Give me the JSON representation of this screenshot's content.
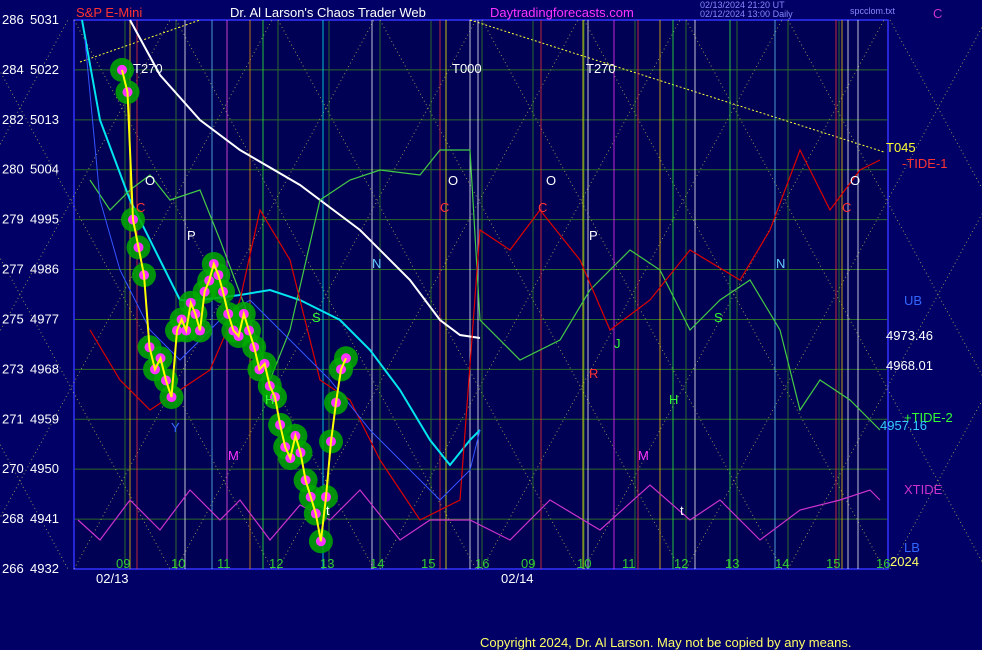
{
  "header": {
    "symbol": "S&P E-Mini",
    "title": "Dr. Al Larson's Chaos Trader Web",
    "site": "Daytradingforecasts.com",
    "stamp1": "02/13/2024 21:20 UT",
    "stamp2": "02/12/2024 13:00 Daily",
    "file": "spcclom.txt",
    "corner": "C"
  },
  "footer": {
    "copyright": "Copyright 2024, Dr. Al Larson. May not be copied by any means."
  },
  "colors": {
    "background": "#000066",
    "plot_bg": "#000055",
    "grid": "#2a6a2a",
    "price_bar": "#00aa00",
    "yellow_avg": "#ffff00",
    "cyan_avg": "#00e5ee",
    "white_avg": "#ffffff",
    "tide_red": "#dd0000",
    "green_line": "#44cc44",
    "xtide": "#cc33cc",
    "magenta_dots": "#ff33ff",
    "axis_text": "#ffffff"
  },
  "chart_data": {
    "type": "line",
    "title": "S&P E-Mini",
    "y_left_ticks": [
      {
        "a": "286",
        "b": "5031"
      },
      {
        "a": "284",
        "b": "5022"
      },
      {
        "a": "282",
        "b": "5013"
      },
      {
        "a": "280",
        "b": "5004"
      },
      {
        "a": "279",
        "b": "4995"
      },
      {
        "a": "277",
        "b": "4986"
      },
      {
        "a": "275",
        "b": "4977"
      },
      {
        "a": "273",
        "b": "4968"
      },
      {
        "a": "271",
        "b": "4959"
      },
      {
        "a": "270",
        "b": "4950"
      },
      {
        "a": "268",
        "b": "4941"
      },
      {
        "a": "266",
        "b": "4932"
      }
    ],
    "ylim": [
      4932,
      5031
    ],
    "x_hour_labels": [
      "09",
      "10",
      "11",
      "12",
      "13",
      "14",
      "15",
      "16",
      "09",
      "10",
      "11",
      "12",
      "13",
      "14",
      "15",
      "16"
    ],
    "x_date_labels": [
      "02/13",
      "02/14"
    ],
    "x_year": "2024",
    "right_labels": {
      "t045": "T045",
      "tide1": "-TIDE-1",
      "ub": "UB",
      "v1": "4973.46",
      "v2": "4968.01",
      "tide2": "+TIDE-2",
      "v3": "4957.16",
      "xtide": "XTIDE",
      "lb": "LB"
    },
    "top_labels": [
      "T270",
      "T000",
      "T270"
    ],
    "price": [
      [
        0.0,
        5022
      ],
      [
        0.1,
        5018
      ],
      [
        0.2,
        4995
      ],
      [
        0.3,
        4990
      ],
      [
        0.4,
        4985
      ],
      [
        0.5,
        4972
      ],
      [
        0.6,
        4968
      ],
      [
        0.7,
        4970
      ],
      [
        0.8,
        4966
      ],
      [
        0.9,
        4963
      ],
      [
        1.0,
        4975
      ],
      [
        1.1,
        4977
      ],
      [
        1.2,
        4975
      ],
      [
        1.3,
        4980
      ],
      [
        1.4,
        4978
      ],
      [
        1.5,
        4975
      ],
      [
        1.6,
        4982
      ],
      [
        1.7,
        4984
      ],
      [
        1.8,
        4987
      ],
      [
        1.9,
        4985
      ],
      [
        2.0,
        4982
      ],
      [
        2.1,
        4978
      ],
      [
        2.2,
        4975
      ],
      [
        2.3,
        4974
      ],
      [
        2.4,
        4978
      ],
      [
        2.5,
        4975
      ],
      [
        2.6,
        4972
      ],
      [
        2.7,
        4968
      ],
      [
        2.8,
        4969
      ],
      [
        2.9,
        4965
      ],
      [
        3.0,
        4963
      ],
      [
        3.1,
        4958
      ],
      [
        3.2,
        4954
      ],
      [
        3.3,
        4952
      ],
      [
        3.4,
        4956
      ],
      [
        3.5,
        4953
      ],
      [
        3.6,
        4948
      ],
      [
        3.7,
        4945
      ],
      [
        3.8,
        4942
      ],
      [
        3.9,
        4937
      ],
      [
        4.0,
        4945
      ],
      [
        4.1,
        4955
      ],
      [
        4.2,
        4962
      ],
      [
        4.3,
        4968
      ],
      [
        4.4,
        4970
      ]
    ],
    "series_note": "x values are trading hours elapsed from 09:00 on 02/13"
  },
  "markers": {
    "O": "O",
    "C": "C",
    "P": "P",
    "N": "N",
    "S": "S",
    "R": "R",
    "H": "H",
    "M": "M",
    "J": "J",
    "t": "t",
    "Y": "Y",
    "C2": "C"
  }
}
